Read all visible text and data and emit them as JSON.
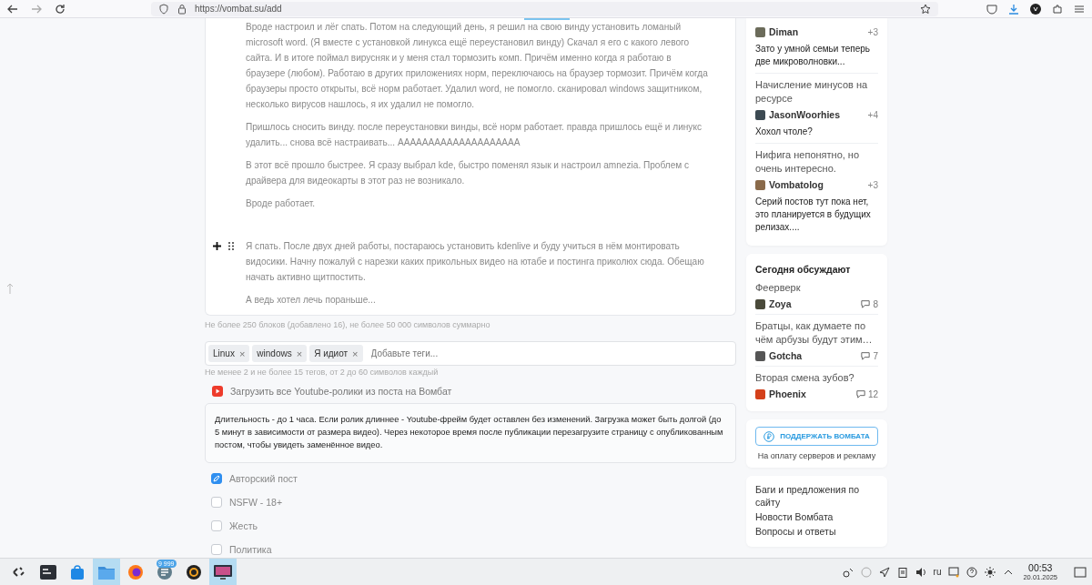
{
  "browser": {
    "url": "https://vombat.su/add"
  },
  "editor": {
    "blocks": [
      {
        "text": "Вроде настроил и лёг спать. Потом на следующий день, я решил на свою винду установить ломаный microsoft word. (Я вместе с установкой линукса ещё переустановил винду) Скачал я его с какого левого сайта. И в итоге поймал вирусняк и у меня стал тормозить комп. Причём именно когда я работаю в браузере (любом). Работаю в других приложениях норм, переключаюсь на браузер тормозит. Причём когда браузеры просто открыты, всё норм работает. Удалил word, не помогло. сканировал windows защитником, несколько вирусов нашлось, я их удалил не помогло.",
        "focused": false
      },
      {
        "text": "Пришлось сносить винду. после переустановки винды, всё норм работает. правда пришлось ещё и линукс удалить... снова всё настраивать... АААААААААААААААААААА",
        "focused": false
      },
      {
        "text": "В этот всё прошло быстрее. Я сразу выбрал kde, быстро поменял язык и настроил amnezia. Проблем с драйвера для видеокарты в этот раз не возникало.",
        "focused": false
      },
      {
        "text": "Вроде работает.",
        "focused": false
      },
      {
        "text": "Я спать. После двух дней работы, постараюсь установить kdenlive и буду учиться в нём монтировать видосики. Начну пожалуй с нарезки каких прикольных видео на ютабе и постинга приколюх сюда. Обещаю начать активно щитпостить.",
        "focused": true
      },
      {
        "text": "А ведь хотел лечь пораньше...",
        "focused": false
      }
    ],
    "hint": "Не более 250 блоков (добавлено 16), не более 50 000 символов суммарно"
  },
  "tags": {
    "items": [
      {
        "label": "Linux",
        "remove": "×"
      },
      {
        "label": "windows",
        "remove": "×"
      },
      {
        "label": "Я идиот",
        "remove": "×"
      }
    ],
    "placeholder": "Добавьте теги...",
    "hint": "Не менее 2 и не более 15 тегов, от 2 до 60 символов каждый"
  },
  "youtube_option": {
    "label": "Загрузить все Youtube-ролики из поста на Вомбат",
    "info": "Длительность - до 1 часа. Если ролик длиннее - Youtube-фрейм будет оставлен без изменений. Загрузка может быть долгой (до 5 минут в зависимости от размера видео). Через некоторое время после публикации перезагрузите страницу с опубликованным постом, чтобы увидеть заменённое видео."
  },
  "options": [
    {
      "label": "Авторский пост",
      "checked": true
    },
    {
      "label": "NSFW - 18+",
      "checked": false
    },
    {
      "label": "Жесть",
      "checked": false
    },
    {
      "label": "Политика",
      "checked": false
    }
  ],
  "sidebar": {
    "comments": [
      {
        "user": "Diman",
        "score": "+3",
        "comment": "Зато у умной семьи теперь две микроволновки..."
      },
      {
        "title": "Начисление минусов на ресурсе",
        "user": "JasonWoorhies",
        "score": "+4",
        "comment": "Хохол чтоле?"
      },
      {
        "title": "Нифига непонятно, но очень интересно.",
        "user": "Vombatolog",
        "score": "+3",
        "comment": "Серий постов тут пока нет, это планируется в будущих релизах...."
      }
    ],
    "discussed": {
      "title": "Сегодня обсуждают",
      "items": [
        {
          "title": "Феерверк",
          "user": "Zoya",
          "comments": "8"
        },
        {
          "title": "Братцы, как думаете по чём арбузы будут этим…",
          "user": "Gotcha",
          "comments": "7"
        },
        {
          "title": "Вторая смена зубов?",
          "user": "Phoenix",
          "comments": "12"
        }
      ]
    },
    "donate": {
      "button": "ПОДДЕРЖАТЬ ВОМБАТА",
      "caption": "На оплату серверов и рекламу"
    },
    "links": [
      "Баги и предложения по сайту",
      "Новости Вомбата",
      "Вопросы и ответы"
    ]
  },
  "taskbar": {
    "apps": [
      {
        "kind": "launcher",
        "selected": false
      },
      {
        "kind": "terminal",
        "selected": false
      },
      {
        "kind": "store",
        "selected": false
      },
      {
        "kind": "files",
        "selected": true
      },
      {
        "kind": "browser",
        "selected": false
      },
      {
        "kind": "messenger",
        "selected": false,
        "badge": "9 999"
      },
      {
        "kind": "recorder",
        "selected": false
      },
      {
        "kind": "monitor",
        "selected": true
      }
    ],
    "language": "ru",
    "time": "00:53",
    "date": "20.01.2025"
  }
}
